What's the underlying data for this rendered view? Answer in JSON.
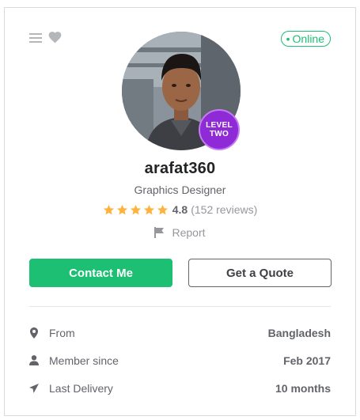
{
  "status": {
    "dot": "•",
    "label": "Online"
  },
  "profile": {
    "username": "arafat360",
    "tagline": "Graphics Designer",
    "level_line1": "LEVEL",
    "level_line2": "TWO"
  },
  "rating": {
    "stars": 5,
    "score": "4.8",
    "reviews": "(152 reviews)"
  },
  "report_label": "Report",
  "actions": {
    "contact_label": "Contact Me",
    "quote_label": "Get a Quote"
  },
  "stats": [
    {
      "icon": "location-pin-icon",
      "label": "From",
      "value": "Bangladesh"
    },
    {
      "icon": "user-icon",
      "label": "Member since",
      "value": "Feb 2017"
    },
    {
      "icon": "paper-plane-icon",
      "label": "Last Delivery",
      "value": "10 months"
    }
  ],
  "colors": {
    "accent": "#1dbf73",
    "star": "#ffb33e",
    "badge": "#8f2bd6",
    "text": "#404145",
    "muted": "#95979d"
  }
}
